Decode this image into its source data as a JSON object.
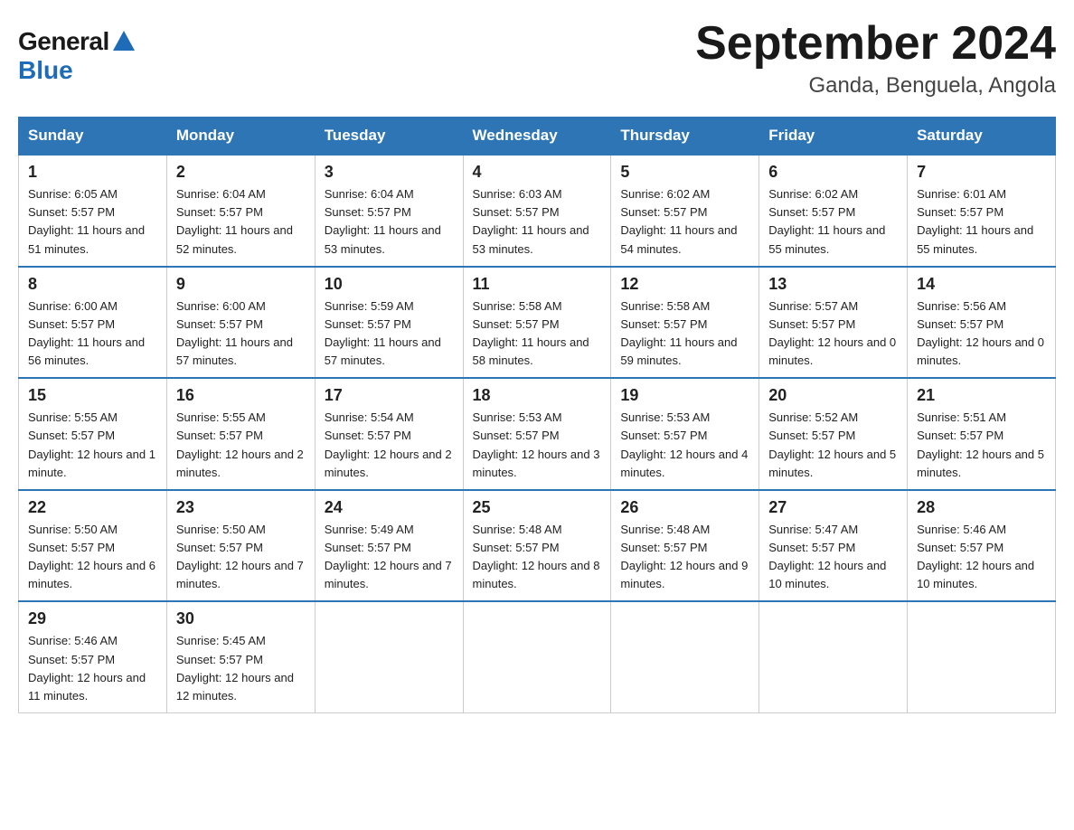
{
  "header": {
    "logo_general": "General",
    "logo_blue": "Blue",
    "title": "September 2024",
    "subtitle": "Ganda, Benguela, Angola"
  },
  "weekdays": [
    "Sunday",
    "Monday",
    "Tuesday",
    "Wednesday",
    "Thursday",
    "Friday",
    "Saturday"
  ],
  "weeks": [
    [
      {
        "day": "1",
        "sunrise": "6:05 AM",
        "sunset": "5:57 PM",
        "daylight": "11 hours and 51 minutes."
      },
      {
        "day": "2",
        "sunrise": "6:04 AM",
        "sunset": "5:57 PM",
        "daylight": "11 hours and 52 minutes."
      },
      {
        "day": "3",
        "sunrise": "6:04 AM",
        "sunset": "5:57 PM",
        "daylight": "11 hours and 53 minutes."
      },
      {
        "day": "4",
        "sunrise": "6:03 AM",
        "sunset": "5:57 PM",
        "daylight": "11 hours and 53 minutes."
      },
      {
        "day": "5",
        "sunrise": "6:02 AM",
        "sunset": "5:57 PM",
        "daylight": "11 hours and 54 minutes."
      },
      {
        "day": "6",
        "sunrise": "6:02 AM",
        "sunset": "5:57 PM",
        "daylight": "11 hours and 55 minutes."
      },
      {
        "day": "7",
        "sunrise": "6:01 AM",
        "sunset": "5:57 PM",
        "daylight": "11 hours and 55 minutes."
      }
    ],
    [
      {
        "day": "8",
        "sunrise": "6:00 AM",
        "sunset": "5:57 PM",
        "daylight": "11 hours and 56 minutes."
      },
      {
        "day": "9",
        "sunrise": "6:00 AM",
        "sunset": "5:57 PM",
        "daylight": "11 hours and 57 minutes."
      },
      {
        "day": "10",
        "sunrise": "5:59 AM",
        "sunset": "5:57 PM",
        "daylight": "11 hours and 57 minutes."
      },
      {
        "day": "11",
        "sunrise": "5:58 AM",
        "sunset": "5:57 PM",
        "daylight": "11 hours and 58 minutes."
      },
      {
        "day": "12",
        "sunrise": "5:58 AM",
        "sunset": "5:57 PM",
        "daylight": "11 hours and 59 minutes."
      },
      {
        "day": "13",
        "sunrise": "5:57 AM",
        "sunset": "5:57 PM",
        "daylight": "12 hours and 0 minutes."
      },
      {
        "day": "14",
        "sunrise": "5:56 AM",
        "sunset": "5:57 PM",
        "daylight": "12 hours and 0 minutes."
      }
    ],
    [
      {
        "day": "15",
        "sunrise": "5:55 AM",
        "sunset": "5:57 PM",
        "daylight": "12 hours and 1 minute."
      },
      {
        "day": "16",
        "sunrise": "5:55 AM",
        "sunset": "5:57 PM",
        "daylight": "12 hours and 2 minutes."
      },
      {
        "day": "17",
        "sunrise": "5:54 AM",
        "sunset": "5:57 PM",
        "daylight": "12 hours and 2 minutes."
      },
      {
        "day": "18",
        "sunrise": "5:53 AM",
        "sunset": "5:57 PM",
        "daylight": "12 hours and 3 minutes."
      },
      {
        "day": "19",
        "sunrise": "5:53 AM",
        "sunset": "5:57 PM",
        "daylight": "12 hours and 4 minutes."
      },
      {
        "day": "20",
        "sunrise": "5:52 AM",
        "sunset": "5:57 PM",
        "daylight": "12 hours and 5 minutes."
      },
      {
        "day": "21",
        "sunrise": "5:51 AM",
        "sunset": "5:57 PM",
        "daylight": "12 hours and 5 minutes."
      }
    ],
    [
      {
        "day": "22",
        "sunrise": "5:50 AM",
        "sunset": "5:57 PM",
        "daylight": "12 hours and 6 minutes."
      },
      {
        "day": "23",
        "sunrise": "5:50 AM",
        "sunset": "5:57 PM",
        "daylight": "12 hours and 7 minutes."
      },
      {
        "day": "24",
        "sunrise": "5:49 AM",
        "sunset": "5:57 PM",
        "daylight": "12 hours and 7 minutes."
      },
      {
        "day": "25",
        "sunrise": "5:48 AM",
        "sunset": "5:57 PM",
        "daylight": "12 hours and 8 minutes."
      },
      {
        "day": "26",
        "sunrise": "5:48 AM",
        "sunset": "5:57 PM",
        "daylight": "12 hours and 9 minutes."
      },
      {
        "day": "27",
        "sunrise": "5:47 AM",
        "sunset": "5:57 PM",
        "daylight": "12 hours and 10 minutes."
      },
      {
        "day": "28",
        "sunrise": "5:46 AM",
        "sunset": "5:57 PM",
        "daylight": "12 hours and 10 minutes."
      }
    ],
    [
      {
        "day": "29",
        "sunrise": "5:46 AM",
        "sunset": "5:57 PM",
        "daylight": "12 hours and 11 minutes."
      },
      {
        "day": "30",
        "sunrise": "5:45 AM",
        "sunset": "5:57 PM",
        "daylight": "12 hours and 12 minutes."
      },
      null,
      null,
      null,
      null,
      null
    ]
  ]
}
